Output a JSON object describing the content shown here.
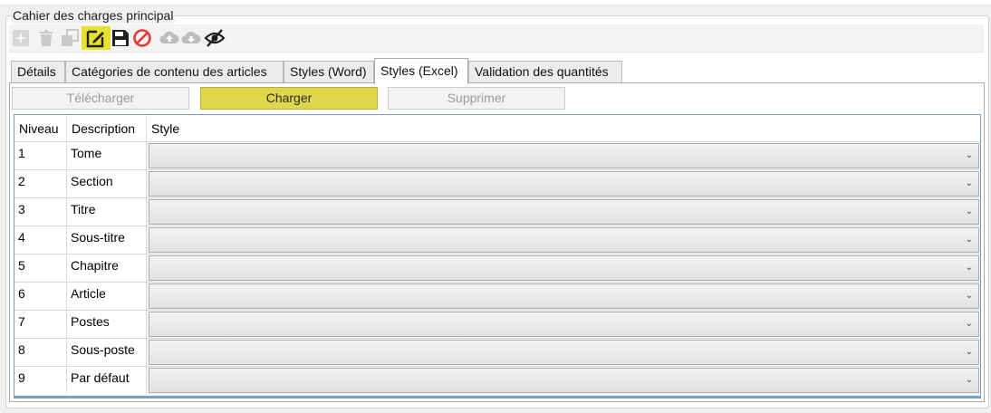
{
  "group_title": "Cahier des charges principal",
  "toolbar": {
    "buttons": [
      {
        "icon": "add-icon",
        "state": "disabled"
      },
      {
        "icon": "trash-icon",
        "state": "disabled"
      },
      {
        "icon": "copy-icon",
        "state": "disabled"
      },
      {
        "icon": "edit-icon",
        "state": "highlighted"
      },
      {
        "icon": "save-icon",
        "state": "enabled"
      },
      {
        "icon": "cancel-icon",
        "state": "enabled"
      },
      {
        "icon": "cloud-upload-icon",
        "state": "disabled"
      },
      {
        "icon": "cloud-download-icon",
        "state": "disabled"
      },
      {
        "icon": "eye-off-icon",
        "state": "enabled"
      }
    ]
  },
  "tabs": [
    {
      "label": "Détails",
      "active": false
    },
    {
      "label": "Catégories de contenu des articles",
      "active": false
    },
    {
      "label": "Styles (Word)",
      "active": false
    },
    {
      "label": "Styles (Excel)",
      "active": true
    },
    {
      "label": "Validation des quantités",
      "active": false
    }
  ],
  "actions": {
    "download": "Télécharger",
    "load": "Charger",
    "delete": "Supprimer"
  },
  "grid": {
    "columns": [
      "Niveau",
      "Description",
      "Style"
    ],
    "rows": [
      {
        "niveau": "1",
        "description": "Tome",
        "style": ""
      },
      {
        "niveau": "2",
        "description": "Section",
        "style": ""
      },
      {
        "niveau": "3",
        "description": "Titre",
        "style": ""
      },
      {
        "niveau": "4",
        "description": "Sous-titre",
        "style": ""
      },
      {
        "niveau": "5",
        "description": "Chapitre",
        "style": ""
      },
      {
        "niveau": "6",
        "description": "Article",
        "style": ""
      },
      {
        "niveau": "7",
        "description": "Postes",
        "style": ""
      },
      {
        "niveau": "8",
        "description": "Sous-poste",
        "style": ""
      },
      {
        "niveau": "9",
        "description": "Par défaut",
        "style": ""
      }
    ]
  },
  "colors": {
    "highlight": "#e6e22e",
    "primary_button": "#dfd64c",
    "grid_border": "#7d9ec0",
    "cancel_red": "#e53935"
  }
}
